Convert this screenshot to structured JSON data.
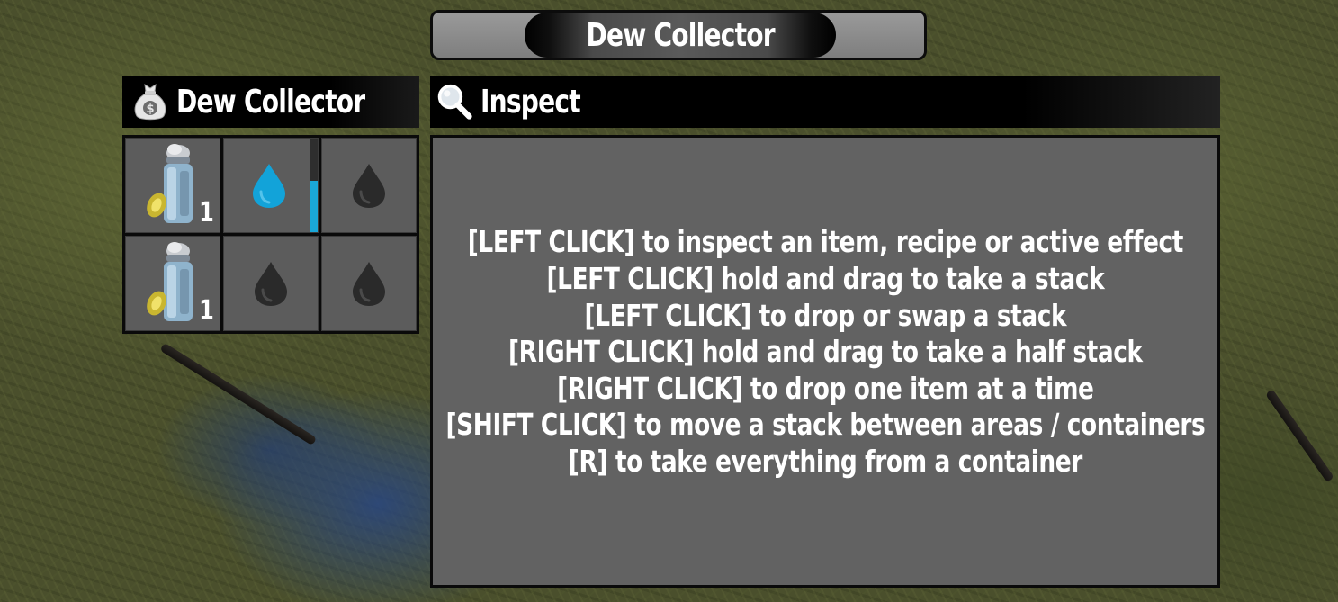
{
  "window": {
    "title": "Dew Collector"
  },
  "container": {
    "header_label": "Dew Collector",
    "header_icon": "money-bag-icon",
    "slots": [
      {
        "item": "gas-mask-filter-jar",
        "count": "1"
      },
      {
        "item": "water-drop",
        "filled": true,
        "progress_fraction": 0.55
      },
      {
        "item": "water-drop",
        "filled": false
      },
      {
        "item": "gas-mask-filter-jar",
        "count": "1"
      },
      {
        "item": "water-drop",
        "filled": false
      },
      {
        "item": "water-drop",
        "filled": false
      }
    ]
  },
  "inspect": {
    "header_label": "Inspect",
    "header_icon": "magnifying-glass-icon",
    "hints": [
      "[LEFT CLICK] to inspect an item, recipe or active effect",
      "[LEFT CLICK] hold and drag to take a stack",
      "[LEFT CLICK] to drop or swap a stack",
      "[RIGHT CLICK] hold and drag to take a half stack",
      "[RIGHT CLICK] to drop one item at a time",
      "[SHIFT CLICK] to move a stack between areas / containers",
      "[R] to take everything from a container"
    ]
  },
  "colors": {
    "water_filled": "#12a3d9",
    "water_empty": "#2a2a2a",
    "slot_bg": "#5c5c5c",
    "panel_bg": "#626262"
  }
}
